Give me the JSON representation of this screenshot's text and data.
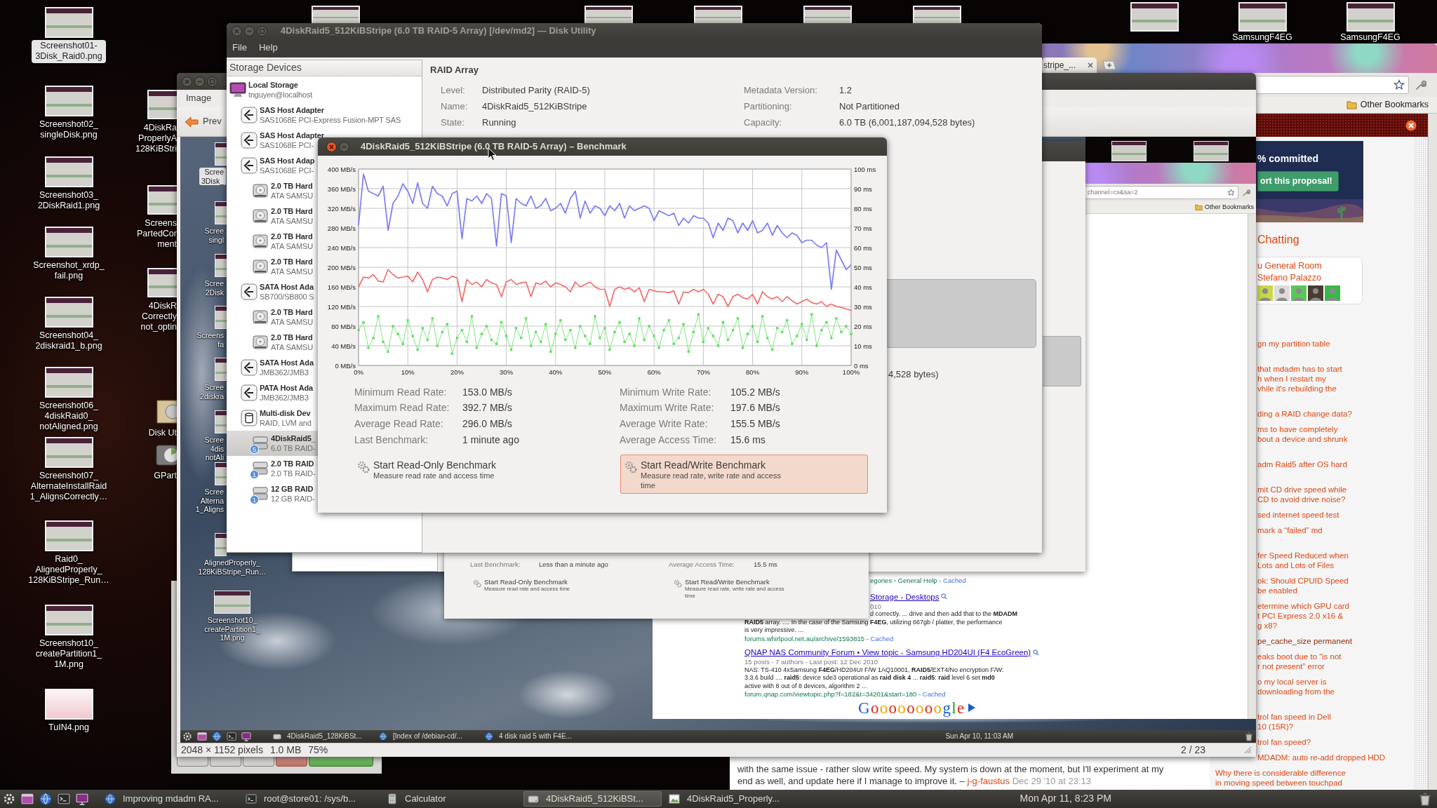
{
  "desktop": {
    "icons": [
      {
        "kind": "screenshot",
        "label": [
          "Screenshot01-",
          "3Disk_Raid0.png"
        ],
        "selected": true
      },
      {
        "kind": "screenshot",
        "label": [
          "Screenshot02_",
          "singleDisk.png"
        ],
        "selected": false
      },
      {
        "kind": "screenshot",
        "label": [
          "Screenshot03_",
          "2DiskRaid1.png"
        ],
        "selected": false
      },
      {
        "kind": "screenshot",
        "label": [
          "Screenshot_xrdp_",
          "fail.png"
        ],
        "selected": false
      },
      {
        "kind": "screenshot",
        "label": [
          "Screenshot04_",
          "2diskraid1_b.png"
        ],
        "selected": false
      },
      {
        "kind": "screenshot",
        "label": [
          "Screenshot06_",
          "4diskRaid0_",
          "notAligned.png"
        ],
        "selected": false
      },
      {
        "kind": "screenshot",
        "label": [
          "Screenshot07_",
          "AlternateInstallRaid",
          "1_AlignsCorrectly…"
        ],
        "selected": false
      },
      {
        "kind": "screenshot",
        "label": [
          "Raid0_",
          "AlignedProperly_",
          "128KiBStripe_Run…"
        ],
        "selected": false
      },
      {
        "kind": "screenshot",
        "label": [
          "Screenshot10_",
          "createPartition1_",
          "1M.png"
        ],
        "selected": false
      },
      {
        "kind": "chart",
        "label": [
          "TuIN4.png"
        ],
        "selected": false
      }
    ],
    "partial_icons": [
      {
        "kind": "thumbnail",
        "label": [
          "4DiskRa",
          "ProperlyA",
          "128KiBStri"
        ]
      },
      {
        "kind": "thumbnail",
        "label": [
          "Screens",
          "PartedCor",
          "ment"
        ]
      },
      {
        "kind": "thumbnail",
        "label": [
          "4DiskR",
          "Correctly",
          "not_optin"
        ]
      },
      {
        "kind": "disk",
        "label": [
          "Disk Ut"
        ]
      },
      {
        "kind": "gparted",
        "label": [
          "GPart"
        ]
      }
    ],
    "top_icons": [
      {
        "kind": "thumbnail"
      },
      {
        "kind": "thumbnail"
      },
      {
        "kind": "thumbnail"
      },
      {
        "kind": "thumbnail"
      },
      {
        "kind": "thumbnail"
      }
    ],
    "top_right_icons": [
      {
        "kind": "thumbnail"
      },
      {
        "kind": "thumbnail",
        "label": [
          "SamsungF4EG"
        ]
      },
      {
        "kind": "thumbnail",
        "label": [
          "SamsungF4EG"
        ]
      }
    ]
  },
  "browser": {
    "tab": "stripe_...",
    "bookmarks": [
      "Other Bookmarks"
    ],
    "proposal": {
      "progress": "% committed",
      "button": "ort this proposal!"
    },
    "chat": {
      "heading": "Chatting",
      "room": "u General Room",
      "user": "Stefano Palazzo",
      "avatars": [
        {
          "color": "#c8d84a"
        },
        {
          "color": "#dcdcdc"
        },
        {
          "color": "#58c858"
        },
        {
          "color": "#4a3a30"
        },
        {
          "color": "#38b848"
        }
      ]
    },
    "links": [
      {
        "lines": [
          "gn my partition table"
        ],
        "visited": false
      },
      {
        "lines": [
          "that mdadm has to start",
          "h when I restart my",
          "vhile it's rebuilding the"
        ],
        "visited": false
      },
      {
        "lines": [
          "ding a RAID change data?"
        ],
        "visited": false
      },
      {
        "lines": [
          "ms to have completely",
          "bout a device and shrunk"
        ],
        "visited": false
      },
      {
        "lines": [
          "adm Raid5 after OS hard"
        ],
        "visited": false
      },
      {
        "lines": [
          "mit CD drive speed while",
          "CD to avoid drive noise?"
        ],
        "visited": false
      },
      {
        "lines": [
          "sed internet speed test"
        ],
        "visited": false
      },
      {
        "lines": [
          "mark a “failed” md"
        ],
        "visited": false
      },
      {
        "lines": [
          "fer Speed Reduced when",
          "Lots and Lots of Files"
        ],
        "visited": false
      },
      {
        "lines": [
          "ok: Should CPUID Speed",
          "be enabled"
        ],
        "visited": false
      },
      {
        "lines": [
          "etermine which GPU card",
          "t PCI Express 2.0 x16 &",
          "g x8?"
        ],
        "visited": false
      },
      {
        "lines": [
          "pe_cache_size permanent"
        ],
        "visited": true
      },
      {
        "lines": [
          "eaks boot due to “is not",
          "r not present” error"
        ],
        "visited": false
      },
      {
        "lines": [
          "o my local server is",
          "downloading from the"
        ],
        "visited": false
      },
      {
        "lines": [
          "trol fan speed in Dell",
          "10 (15R)?"
        ],
        "visited": false
      },
      {
        "lines": [
          "trol fan speed?"
        ],
        "visited": false
      },
      {
        "lines": [
          "MDADM: auto re-add dropped HDD"
        ],
        "visited": false
      },
      {
        "lines": [
          "Why there is considerable difference",
          "in moving speed between touchpad"
        ],
        "visited": false
      }
    ],
    "comment": {
      "lines": [
        "with the same issue - rather slow write speed. My system is down at the moment, but I'll experiment at my",
        "end as well, and update here if I manage to improve it. –"
      ],
      "author": "j-g-faustus",
      "date": "Dec 29 '10 at 23:13"
    }
  },
  "calculator": {
    "buttons": [
      {
        "kind": "key"
      },
      {
        "kind": "key"
      },
      {
        "kind": "key"
      },
      {
        "kind": "clear"
      },
      {
        "kind": "equals"
      }
    ]
  },
  "image_viewer": {
    "menu": [
      "Image"
    ],
    "toolbar": [
      {
        "kind": "previous",
        "label": "Prev"
      }
    ],
    "screenshot": {
      "icons": [
        {
          "label": [
            "Scree",
            "3Disk_"
          ],
          "selected": true
        },
        {
          "label": [
            "Scree",
            "singl"
          ],
          "selected": false
        },
        {
          "label": [
            "Scree",
            "2Disk"
          ],
          "selected": false
        },
        {
          "label": [
            "Screens",
            "fa"
          ],
          "selected": false
        },
        {
          "label": [
            "Scree",
            "2diskra"
          ],
          "selected": false
        },
        {
          "label": [
            "Scree",
            "4dis",
            "notAli"
          ],
          "selected": false
        },
        {
          "label": [
            "Scree",
            "Alterna",
            "1_Aligns"
          ],
          "selected": false
        },
        {
          "label": [
            "AlignedProperly_",
            "128KiBStripe_Run…"
          ],
          "selected": false
        },
        {
          "label": [
            "Screenshot10_",
            "createPartition1_",
            "1M.png"
          ],
          "selected": false
        }
      ],
      "top_icons": [
        {
          "kind": "thumbnail"
        },
        {
          "kind": "thumbnail"
        }
      ],
      "benchmark": {
        "stats": [
          {
            "label": "Last Benchmark:",
            "value": "Less than a minute ago"
          },
          {
            "label": "Average Access Time:",
            "value": "15.5 ms"
          }
        ],
        "buttons": [
          {
            "title": "Start Read-Only Benchmark",
            "description": [
              "Measure read rate and access time"
            ]
          },
          {
            "title": "Start Read/Write Benchmark",
            "description": [
              "Measure read rate, write rate and access",
              "time"
            ]
          }
        ]
      },
      "browser": {
        "address": "channel=cs&sa=2",
        "bookmarks": [
          "Other Bookmarks"
        ],
        "results": [
          {
            "kind": "url-only",
            "url": "egories › General Help -",
            "cached": "Cached"
          },
          {
            "kind": "result",
            "title": "Storage - Desktops",
            "meta": "010",
            "snippet": [
              "d correctly. ... drive and then add that to the **MDADM**",
              "**RAID5** array. .... In the case of the Samsung **F4EG**, utilizing 667gb / platter, the performance",
              "is very impressive. ..."
            ],
            "url": "forums.whirlpool.net.au/archive/1593815 -",
            "cached": "Cached"
          },
          {
            "kind": "result",
            "title": "QNAP NAS Community Forum • View topic - Samsung HD204UI (F4 EcoGreen)",
            "meta": "15 posts - 7 authors - Last post: 12 Dec 2010",
            "snippet": [
              "NAS: TS-410 4xSamsung **F4EG**/HD204UI F/W 1AQ10001, **RAID5**/EXT4/No encryption F/W:",
              "3.3.6 build .... **raid5**: device sde3 operational as **raid disk 4** ... **raid5**: **raid** level 6 set **md0**",
              "active with 8 out of 8 devices, algorithm 2 ..."
            ],
            "url": "forum.qnap.com/viewtopic.php?f=182&t=34201&start=180 -",
            "cached": "Cached"
          }
        ],
        "logo": "Goooooooogle"
      },
      "taskbar": {
        "items": [
          {
            "kind": "disk",
            "label": "4DiskRaid5_128KiBSt..."
          },
          {
            "kind": "browser",
            "label": "[Index of /debian-cd/..."
          },
          {
            "kind": "browser",
            "label": "4 disk raid 5 with F4E..."
          }
        ],
        "clock": "Sun Apr 10, 11:03 AM"
      }
    },
    "status": [
      "2048 × 1152 pixels",
      "1.0 MB",
      "75%"
    ],
    "position": "2 / 23"
  },
  "disk_utility": {
    "title": "4DiskRaid5_512KiBStripe (6.0 TB RAID-5 Array) [/dev/md2] — Disk Utility",
    "menu": [
      "File",
      "Help"
    ],
    "sidebar": {
      "header": "Storage Devices",
      "items": [
        {
          "kind": "computer",
          "title": "Local Storage",
          "subtitle": "tnguyen@localhost",
          "selected": false,
          "children": [
            {
              "kind": "adapter",
              "title": "SAS Host Adapter",
              "subtitle": "SAS1068E PCI-Express Fusion-MPT SAS",
              "selected": false
            },
            {
              "kind": "adapter",
              "title": "SAS Host Adapter",
              "subtitle": "SAS1068E PCI-",
              "selected": false
            },
            {
              "kind": "adapter",
              "title": "SAS Host Adap",
              "subtitle": "SAS1068E PCI-",
              "selected": false,
              "children": [
                {
                  "kind": "hdd",
                  "title": "2.0 TB Hard",
                  "subtitle": "ATA SAMSU",
                  "selected": false
                },
                {
                  "kind": "hdd",
                  "title": "2.0 TB Hard",
                  "subtitle": "ATA SAMSU",
                  "selected": false
                },
                {
                  "kind": "hdd",
                  "title": "2.0 TB Hard",
                  "subtitle": "ATA SAMSU",
                  "selected": false
                },
                {
                  "kind": "hdd",
                  "title": "2.0 TB Hard",
                  "subtitle": "ATA SAMSU",
                  "selected": false
                }
              ]
            },
            {
              "kind": "adapter",
              "title": "SATA Host Ada",
              "subtitle": "SB700/SB800 S",
              "selected": false,
              "children": [
                {
                  "kind": "hdd",
                  "title": "2.0 TB Hard",
                  "subtitle": "ATA SAMSU",
                  "selected": false
                },
                {
                  "kind": "hdd",
                  "title": "2.0 TB Hard",
                  "subtitle": "ATA SAMSU",
                  "selected": false
                }
              ]
            },
            {
              "kind": "adapter",
              "title": "SATA Host Ada",
              "subtitle": "JMB362/JMB3",
              "selected": false
            },
            {
              "kind": "adapter",
              "title": "PATA Host Ada",
              "subtitle": "JMB362/JMB3",
              "selected": false
            },
            {
              "kind": "multidisk",
              "title": "Multi-disk Dev",
              "subtitle": "RAID, LVM and",
              "selected": false,
              "children": [
                {
                  "kind": "raid",
                  "badge": "5",
                  "title": "4DiskRaid5_",
                  "subtitle": "6.0 TB RAID-",
                  "selected": true
                },
                {
                  "kind": "raid",
                  "badge": "1",
                  "title": "2.0 TB RAID",
                  "subtitle": "2.0 TB RAID-",
                  "selected": false
                },
                {
                  "kind": "raid",
                  "badge": "1",
                  "title": "12 GB RAID",
                  "subtitle": "12 GB RAID-",
                  "selected": false
                }
              ]
            }
          ]
        }
      ]
    },
    "raid_array": {
      "heading": "RAID Array",
      "fields": [
        {
          "label": "Level:",
          "value": "Distributed Parity (RAID-5)"
        },
        {
          "label": "Metadata Version:",
          "value": "1.2"
        },
        {
          "label": "Name:",
          "value": "4DiskRaid5_512KiBStripe"
        },
        {
          "label": "Partitioning:",
          "value": "Not Partitioned"
        },
        {
          "label": "State:",
          "value": "Running"
        },
        {
          "label": "Capacity:",
          "value": "6.0 TB (6,001,187,094,528 bytes)"
        }
      ]
    },
    "volume_capacity": "4,528 bytes)"
  },
  "benchmark": {
    "title": "4DiskRaid5_512KiBStripe (6.0 TB RAID-5 Array) – Benchmark",
    "chart_data": {
      "type": "line",
      "grid": true,
      "x": [
        0,
        1,
        2,
        3,
        4,
        5,
        6,
        7,
        8,
        9,
        10,
        11,
        12,
        13,
        14,
        15,
        16,
        17,
        18,
        19,
        20,
        21,
        22,
        23,
        24,
        25,
        26,
        27,
        28,
        29,
        30,
        31,
        32,
        33,
        34,
        35,
        36,
        37,
        38,
        39,
        40,
        41,
        42,
        43,
        44,
        45,
        46,
        47,
        48,
        49,
        50,
        51,
        52,
        53,
        54,
        55,
        56,
        57,
        58,
        59,
        60,
        61,
        62,
        63,
        64,
        65,
        66,
        67,
        68,
        69,
        70,
        71,
        72,
        73,
        74,
        75,
        76,
        77,
        78,
        79,
        80,
        81,
        82,
        83,
        84,
        85,
        86,
        87,
        88,
        89,
        90,
        91,
        92,
        93,
        94,
        95,
        96,
        97,
        98,
        99,
        100
      ],
      "xlim": [
        0,
        100
      ],
      "ylim": [
        0,
        400
      ],
      "y2lim": [
        0,
        100
      ],
      "xticks": [
        {
          "value": 0,
          "label": "0%"
        },
        {
          "value": 10,
          "label": "10%"
        },
        {
          "value": 20,
          "label": "20%"
        },
        {
          "value": 30,
          "label": "30%"
        },
        {
          "value": 40,
          "label": "40%"
        },
        {
          "value": 50,
          "label": "50%"
        },
        {
          "value": 60,
          "label": "60%"
        },
        {
          "value": 70,
          "label": "70%"
        },
        {
          "value": 80,
          "label": "80%"
        },
        {
          "value": 90,
          "label": "90%"
        },
        {
          "value": 100,
          "label": "100%"
        }
      ],
      "yticks": [
        {
          "value": 0,
          "label": "0 MB/s"
        },
        {
          "value": 40,
          "label": "40 MB/s"
        },
        {
          "value": 80,
          "label": "80 MB/s"
        },
        {
          "value": 120,
          "label": "120 MB/s"
        },
        {
          "value": 160,
          "label": "160 MB/s"
        },
        {
          "value": 200,
          "label": "200 MB/s"
        },
        {
          "value": 240,
          "label": "240 MB/s"
        },
        {
          "value": 280,
          "label": "280 MB/s"
        },
        {
          "value": 320,
          "label": "320 MB/s"
        },
        {
          "value": 360,
          "label": "360 MB/s"
        },
        {
          "value": 400,
          "label": "400 MB/s"
        }
      ],
      "y2ticks": [
        {
          "value": 0,
          "label": "0 ms"
        },
        {
          "value": 10,
          "label": "10 ms"
        },
        {
          "value": 20,
          "label": "20 ms"
        },
        {
          "value": 30,
          "label": "30 ms"
        },
        {
          "value": 40,
          "label": "40 ms"
        },
        {
          "value": 50,
          "label": "50 ms"
        },
        {
          "value": 60,
          "label": "60 ms"
        },
        {
          "value": 70,
          "label": "70 ms"
        },
        {
          "value": 80,
          "label": "80 ms"
        },
        {
          "value": 90,
          "label": "90 ms"
        },
        {
          "value": 100,
          "label": "100 ms"
        }
      ],
      "series": [
        {
          "color": "#7b7bf7",
          "values": [
            285,
            390,
            355,
            350,
            345,
            365,
            275,
            330,
            345,
            370,
            355,
            330,
            372,
            330,
            320,
            365,
            350,
            345,
            325,
            350,
            355,
            258,
            340,
            335,
            345,
            330,
            350,
            340,
            243,
            350,
            345,
            250,
            340,
            330,
            325,
            345,
            320,
            325,
            340,
            315,
            320,
            330,
            310,
            340,
            355,
            300,
            335,
            310,
            325,
            320,
            305,
            325,
            315,
            330,
            300,
            325,
            315,
            320,
            325,
            320,
            295,
            315,
            310,
            305,
            310,
            285,
            300,
            290,
            305,
            300,
            300,
            290,
            260,
            290,
            275,
            300,
            295,
            270,
            290,
            275,
            295,
            270,
            275,
            290,
            265,
            285,
            270,
            260,
            270,
            265,
            250,
            255,
            255,
            245,
            240,
            250,
            155,
            235,
            215,
            195,
            205
          ]
        },
        {
          "color": "#f26c6c",
          "values": [
            160,
            180,
            178,
            185,
            172,
            170,
            195,
            185,
            178,
            180,
            182,
            170,
            190,
            175,
            150,
            175,
            180,
            178,
            175,
            182,
            178,
            130,
            175,
            165,
            170,
            160,
            175,
            168,
            165,
            140,
            170,
            175,
            165,
            168,
            170,
            140,
            168,
            165,
            172,
            160,
            168,
            165,
            160,
            150,
            170,
            160,
            165,
            170,
            160,
            155,
            155,
            120,
            155,
            160,
            155,
            158,
            150,
            158,
            130,
            155,
            152,
            150,
            150,
            148,
            152,
            125,
            150,
            148,
            155,
            150,
            155,
            145,
            125,
            145,
            140,
            120,
            140,
            145,
            138,
            135,
            145,
            125,
            150,
            140,
            135,
            140,
            130,
            140,
            132,
            125,
            130,
            135,
            128,
            125,
            130,
            120,
            125,
            120,
            118,
            115,
            112
          ]
        },
        {
          "color": "#5fe05f",
          "axis": "y2",
          "values": [
            18,
            22,
            9,
            14,
            25,
            12,
            7,
            20,
            16,
            11,
            23,
            15,
            8,
            19,
            13,
            24,
            10,
            17,
            21,
            6,
            14,
            18,
            12,
            25,
            9,
            16,
            20,
            13,
            11,
            22,
            15,
            8,
            19,
            14,
            24,
            10,
            17,
            12,
            21,
            7,
            16,
            23,
            13,
            18,
            9,
            20,
            15,
            11,
            25,
            14,
            19,
            8,
            17,
            22,
            12,
            16,
            10,
            24,
            13,
            20,
            15,
            9,
            18,
            23,
            11,
            14,
            21,
            7,
            17,
            26,
            12,
            19,
            15,
            10,
            22,
            13,
            18,
            24,
            9,
            16,
            20,
            12,
            25,
            14,
            8,
            19,
            17,
            23,
            11,
            15,
            21,
            13,
            26,
            10,
            18,
            22,
            14,
            24,
            17,
            20,
            16
          ]
        }
      ]
    },
    "stats": [
      {
        "label": "Minimum Read Rate:",
        "value": "153.0 MB/s"
      },
      {
        "label": "Minimum Write Rate:",
        "value": "105.2 MB/s"
      },
      {
        "label": "Maximum Read Rate:",
        "value": "392.7 MB/s"
      },
      {
        "label": "Maximum Write Rate:",
        "value": "197.6 MB/s"
      },
      {
        "label": "Average Read Rate:",
        "value": "296.0 MB/s"
      },
      {
        "label": "Average Write Rate:",
        "value": "155.5 MB/s"
      },
      {
        "label": "Last Benchmark:",
        "value": "1 minute ago"
      },
      {
        "label": "Average Access Time:",
        "value": "15.6 ms"
      }
    ],
    "buttons": [
      {
        "title": "Start Read-Only Benchmark",
        "description": [
          "Measure read rate and access time"
        ],
        "highlighted": false
      },
      {
        "title": "Start Read/Write Benchmark",
        "description": [
          "Measure read rate, write rate and access",
          "time"
        ],
        "highlighted": true
      }
    ]
  },
  "taskbar": {
    "launchers": [
      {
        "kind": "ubuntu"
      },
      {
        "kind": "files"
      },
      {
        "kind": "browser"
      },
      {
        "kind": "terminal"
      },
      {
        "kind": "monitor"
      }
    ],
    "items": [
      {
        "kind": "browser",
        "label": "Improving mdadm RA...",
        "selected": false
      },
      {
        "kind": "terminal",
        "label": "root@store01: /sys/b...",
        "selected": false
      },
      {
        "kind": "calculator",
        "label": "Calculator",
        "selected": false
      },
      {
        "kind": "disk",
        "label": "4DiskRaid5_512KiBSt...",
        "selected": true
      },
      {
        "kind": "image",
        "label": "4DiskRaid5_Properly...",
        "selected": false
      }
    ],
    "clock": "Mon Apr 11, 8:23 PM"
  }
}
